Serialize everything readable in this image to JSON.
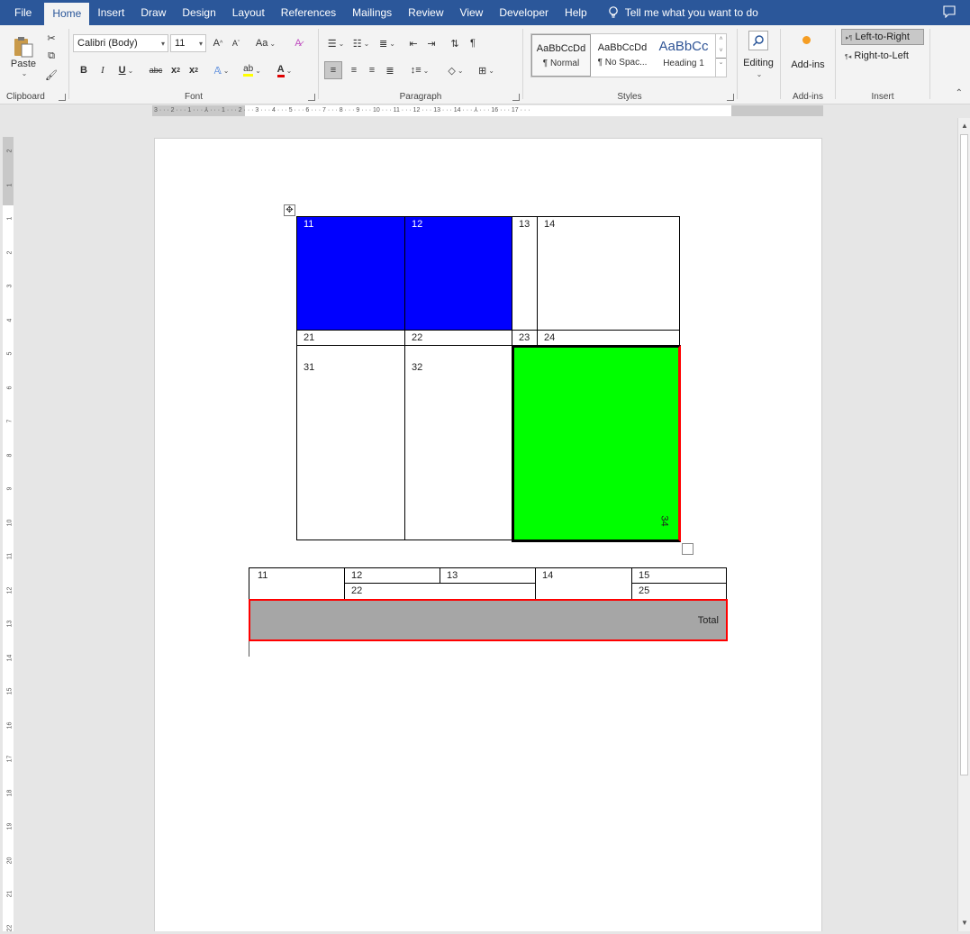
{
  "tabs": {
    "file": "File",
    "home": "Home",
    "insert": "Insert",
    "draw": "Draw",
    "design": "Design",
    "layout": "Layout",
    "references": "References",
    "mailings": "Mailings",
    "review": "Review",
    "view": "View",
    "developer": "Developer",
    "help": "Help",
    "tell_me": "Tell me what you want to do"
  },
  "ribbon": {
    "clipboard": {
      "label": "Clipboard",
      "paste": "Paste"
    },
    "font": {
      "label": "Font",
      "family": "Calibri (Body)",
      "size": "11",
      "grow": "A",
      "shrink": "A",
      "change_case": "Aa",
      "bold": "B",
      "italic": "I",
      "underline": "U",
      "strikethrough": "abc",
      "subscript": "x",
      "superscript": "x",
      "highlight": "ab",
      "font_color": "A"
    },
    "paragraph": {
      "label": "Paragraph",
      "pilcrow": "¶"
    },
    "styles": {
      "label": "Styles",
      "items": [
        {
          "sample": "AaBbCcDd",
          "name": "¶ Normal"
        },
        {
          "sample": "AaBbCcDd",
          "name": "¶ No Spac..."
        },
        {
          "sample": "AaBbCc",
          "name": "Heading 1"
        }
      ]
    },
    "editing": {
      "label": "Editing"
    },
    "addins": {
      "label": "Add-ins",
      "button": "Add-ins"
    },
    "insert_group": {
      "label": "Insert",
      "ltr": "Left-to-Right",
      "rtl": "Right-to-Left"
    }
  },
  "ruler": {
    "horizontal": "3 · · · 2 · · · 1 · · · ⅄ · · · 1 · · · 2 · · · 3 · · · 4 · · · 5 · · · 6 · · · 7 · · · 8 · · · 9 · · · 10 · · · 11 · · · 12 · · · 13 · · · 14 · · · ⅄ · · · 16 · · · 17 · · ·",
    "vertical": [
      "2",
      "1",
      "1",
      "2",
      "3",
      "4",
      "5",
      "6",
      "7",
      "8",
      "9",
      "10",
      "11",
      "12",
      "13",
      "14",
      "15",
      "16",
      "17",
      "18",
      "19",
      "20",
      "21",
      "22"
    ]
  },
  "table1": {
    "r1": [
      "11",
      "12",
      "13",
      "14"
    ],
    "r2": [
      "21",
      "22",
      "23",
      "24"
    ],
    "r3": [
      "31",
      "32",
      "34"
    ]
  },
  "table2": {
    "r1": [
      "11",
      "12",
      "13",
      "14",
      "15"
    ],
    "r2": [
      "22",
      "25"
    ],
    "total": "Total"
  },
  "colors": {
    "blue_cell": "#0000ff",
    "green_cell": "#00ff00",
    "red_border": "#ff0000",
    "total_fill": "#a6a6a6",
    "accent": "#2b579a"
  }
}
